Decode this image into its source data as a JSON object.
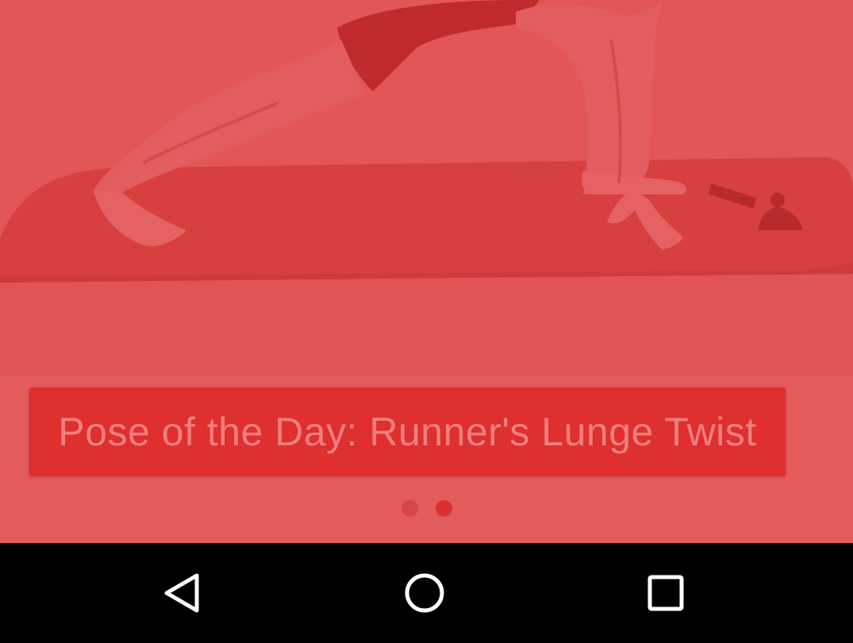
{
  "hero": {
    "image_description_icon": "yoga-pose-photo"
  },
  "banner": {
    "title": "Pose of the Day: Runner's Lunge Twist"
  },
  "pager": {
    "page_count": 2,
    "active_index": 1
  },
  "navbar": {
    "back_icon": "back-triangle-icon",
    "home_icon": "home-circle-icon",
    "recents_icon": "recents-square-icon"
  },
  "colors": {
    "overlay": "#e45b5b",
    "banner": "#df2f2f",
    "banner_text": "#f07f7f",
    "navbar": "#000000"
  }
}
